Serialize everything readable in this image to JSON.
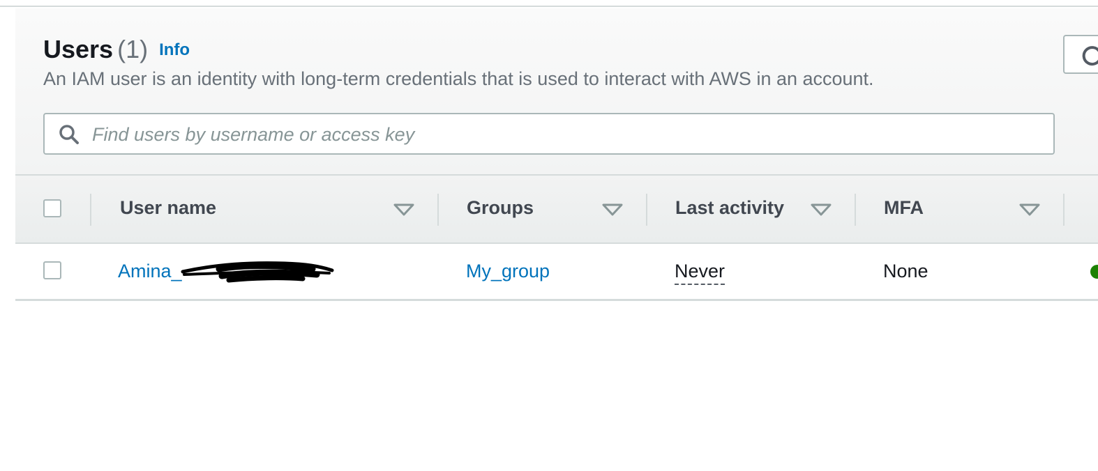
{
  "header": {
    "title": "Users",
    "count": "(1)",
    "info_label": "Info",
    "description": "An IAM user is an identity with long-term credentials that is used to interact with AWS in an account."
  },
  "search": {
    "placeholder": "Find users by username or access key",
    "value": ""
  },
  "table": {
    "columns": [
      {
        "label": "User name"
      },
      {
        "label": "Groups"
      },
      {
        "label": "Last activity"
      },
      {
        "label": "MFA"
      }
    ],
    "rows": [
      {
        "user_name": "Amina_",
        "groups": "My_group",
        "last_activity": "Never",
        "mfa": "None"
      }
    ]
  },
  "colors": {
    "link": "#0073bb",
    "status_ok": "#1d8102"
  },
  "icons": {
    "search": "search-icon",
    "refresh": "refresh-icon",
    "sort": "caret-down-icon"
  }
}
